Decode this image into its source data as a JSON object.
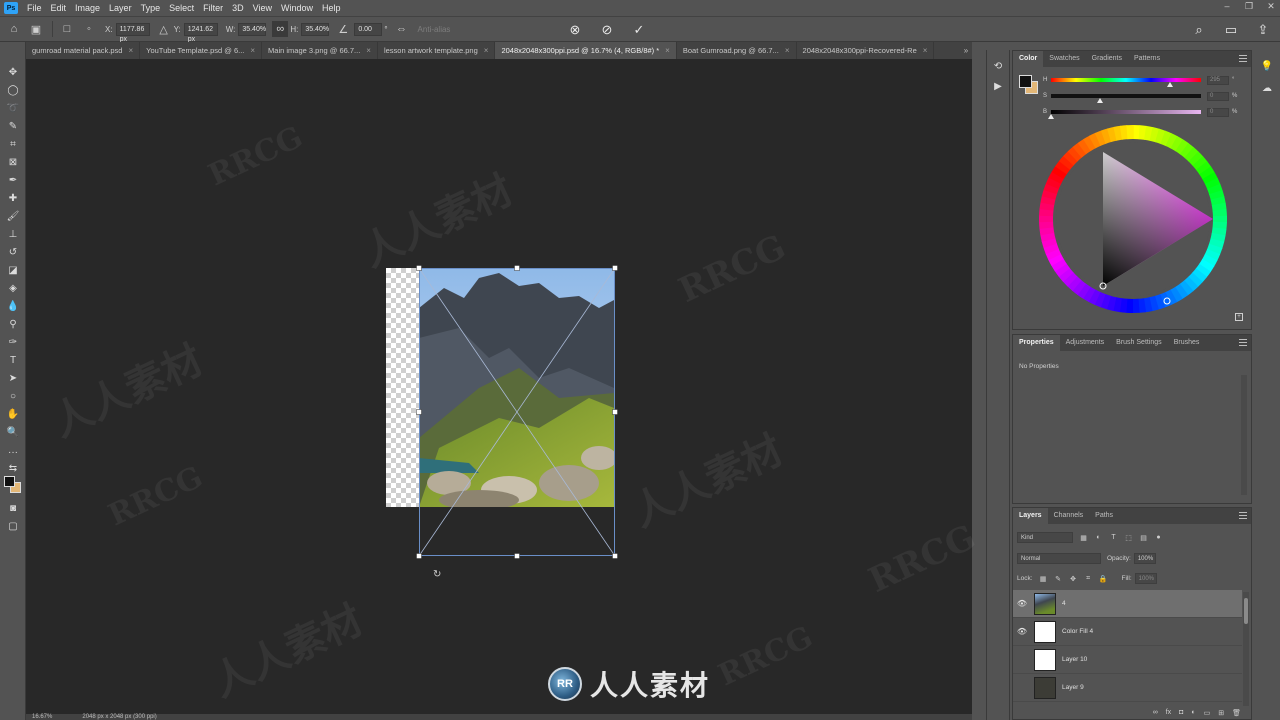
{
  "app": {
    "logo": "Ps"
  },
  "menu": [
    "File",
    "Edit",
    "Image",
    "Layer",
    "Type",
    "Select",
    "Filter",
    "3D",
    "View",
    "Window",
    "Help"
  ],
  "window_controls": [
    "minimize",
    "restore",
    "close"
  ],
  "options_bar": {
    "x_label": "X:",
    "x_value": "1177.86 px",
    "y_label": "Y:",
    "y_value": "1241.62 px",
    "w_label": "W:",
    "w_value": "35.40%",
    "h_label": "H:",
    "h_value": "35.40%",
    "angle_value": "0.00",
    "angle_unit": "°",
    "antialias_label": "Anti-alias"
  },
  "tabs": [
    {
      "label": "gumroad material pack.psd",
      "active": false
    },
    {
      "label": "YouTube Template.psd @ 6...",
      "active": false
    },
    {
      "label": "Main image 3.png @ 66.7...",
      "active": false
    },
    {
      "label": "lesson artwork template.png",
      "active": false
    },
    {
      "label": "2048x2048x300ppi.psd @ 16.7% (4, RGB/8#) *",
      "active": true
    },
    {
      "label": "Boat Gumroad.png @ 66.7...",
      "active": false
    },
    {
      "label": "2048x2048x300ppi-Recovered-Re",
      "active": false
    }
  ],
  "tab_overflow": "»",
  "tools": [
    "move-tool",
    "marquee-tool",
    "lasso-tool",
    "quick-select-tool",
    "crop-tool",
    "frame-tool",
    "eyedropper-tool",
    "healing-brush-tool",
    "brush-tool",
    "clone-stamp-tool",
    "history-brush-tool",
    "eraser-tool",
    "gradient-tool",
    "blur-tool",
    "dodge-tool",
    "pen-tool",
    "type-tool",
    "path-select-tool",
    "shape-tool",
    "hand-tool",
    "zoom-tool",
    "more-tools"
  ],
  "color_panel": {
    "tabs": [
      "Color",
      "Swatches",
      "Gradients",
      "Patterns"
    ],
    "active_tab": "Color",
    "h_label": "H",
    "h_value": "295",
    "s_label": "S",
    "s_value": "0",
    "b_label": "B",
    "b_value": "0",
    "fg_color": "#111111",
    "bg_color": "#e3b777"
  },
  "properties_panel": {
    "tabs": [
      "Properties",
      "Adjustments",
      "Brush Settings",
      "Brushes"
    ],
    "active_tab": "Properties",
    "empty_text": "No Properties"
  },
  "layers_panel": {
    "tabs": [
      "Layers",
      "Channels",
      "Paths"
    ],
    "active_tab": "Layers",
    "kind_placeholder": "Kind",
    "blend_mode": "Normal",
    "opacity_label": "Opacity:",
    "opacity_value": "100%",
    "lock_label": "Lock:",
    "fill_label": "Fill:",
    "fill_value": "100%",
    "layers": [
      {
        "name": "4",
        "visible": true,
        "selected": true
      },
      {
        "name": "Color Fill 4",
        "visible": true,
        "selected": false
      },
      {
        "name": "Layer 10",
        "visible": false,
        "selected": false
      },
      {
        "name": "Layer 9",
        "visible": false,
        "selected": false
      }
    ],
    "footer_icons": [
      "link-icon",
      "fx-icon",
      "mask-icon",
      "adjustment-icon",
      "group-icon",
      "new-layer-icon",
      "trash-icon"
    ]
  },
  "status_bar": {
    "zoom": "16.67%",
    "doc_size": "2048 px x 2048 px (300 ppi)"
  },
  "watermark": {
    "text": "人人素材",
    "latin": "RRCG"
  }
}
